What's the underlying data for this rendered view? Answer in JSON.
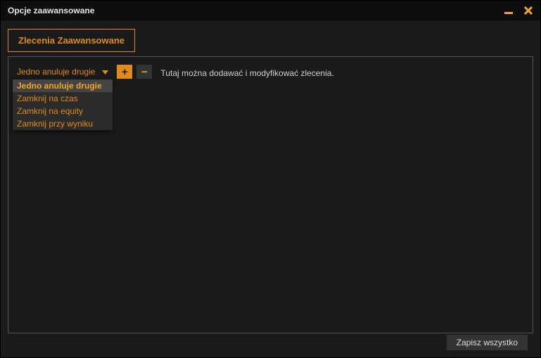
{
  "window": {
    "title": "Opcje zaawansowane"
  },
  "tabs": {
    "advanced_orders": "Zlecenia Zaawansowane"
  },
  "toolbar": {
    "dropdown_selected": "Jedno anuluje drugie",
    "dropdown_options": [
      "Jedno anuluje drugie",
      "Zamknij na czas",
      "Zamknij na equity",
      "Zamknij przy wyniku"
    ],
    "add_label": "+",
    "remove_label": "−",
    "hint": "Tutaj można dodawać i modyfikować zlecenia."
  },
  "footer": {
    "save_all": "Zapisz wszystko"
  },
  "colors": {
    "accent": "#e08a1a",
    "bg": "#1a1a1a"
  }
}
